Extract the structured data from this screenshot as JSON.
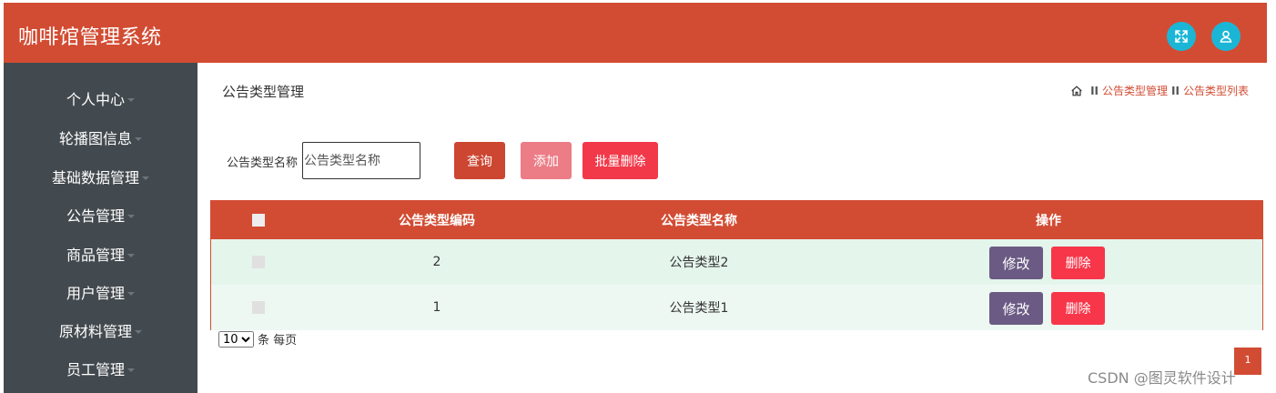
{
  "header": {
    "title": "咖啡馆管理系统",
    "icons": {
      "expand": "fullscreen-icon",
      "user": "user-icon"
    }
  },
  "sidebar": {
    "items": [
      {
        "label": "个人中心"
      },
      {
        "label": "轮播图信息"
      },
      {
        "label": "基础数据管理"
      },
      {
        "label": "公告管理"
      },
      {
        "label": "商品管理"
      },
      {
        "label": "用户管理"
      },
      {
        "label": "原材料管理"
      },
      {
        "label": "员工管理"
      }
    ]
  },
  "main": {
    "title": "公告类型管理",
    "breadcrumb": {
      "separator": "II",
      "items": [
        "公告类型管理",
        "公告类型列表"
      ]
    },
    "search": {
      "label": "公告类型名称",
      "placeholder": "公告类型名称",
      "value": ""
    },
    "buttons": {
      "query": "查询",
      "add": "添加",
      "batch_delete": "批量删除"
    },
    "table": {
      "columns": [
        "公告类型编码",
        "公告类型名称",
        "操作"
      ],
      "rows": [
        {
          "code": "2",
          "name": "公告类型2",
          "edit": "修改",
          "delete": "删除"
        },
        {
          "code": "1",
          "name": "公告类型1",
          "edit": "修改",
          "delete": "删除"
        }
      ]
    },
    "pagination": {
      "page_size": "10",
      "page_size_options": [
        "10"
      ],
      "per_page_label": "条 每页",
      "current_page": "1"
    }
  },
  "watermark": "CSDN @图灵软件设计",
  "colors": {
    "primary": "#d24c33",
    "sidebar": "#434a4f",
    "icon_bg": "#1bb6d6",
    "add_button": "#ec7c86",
    "delete_button": "#f7364a",
    "edit_button": "#6b5b84"
  }
}
